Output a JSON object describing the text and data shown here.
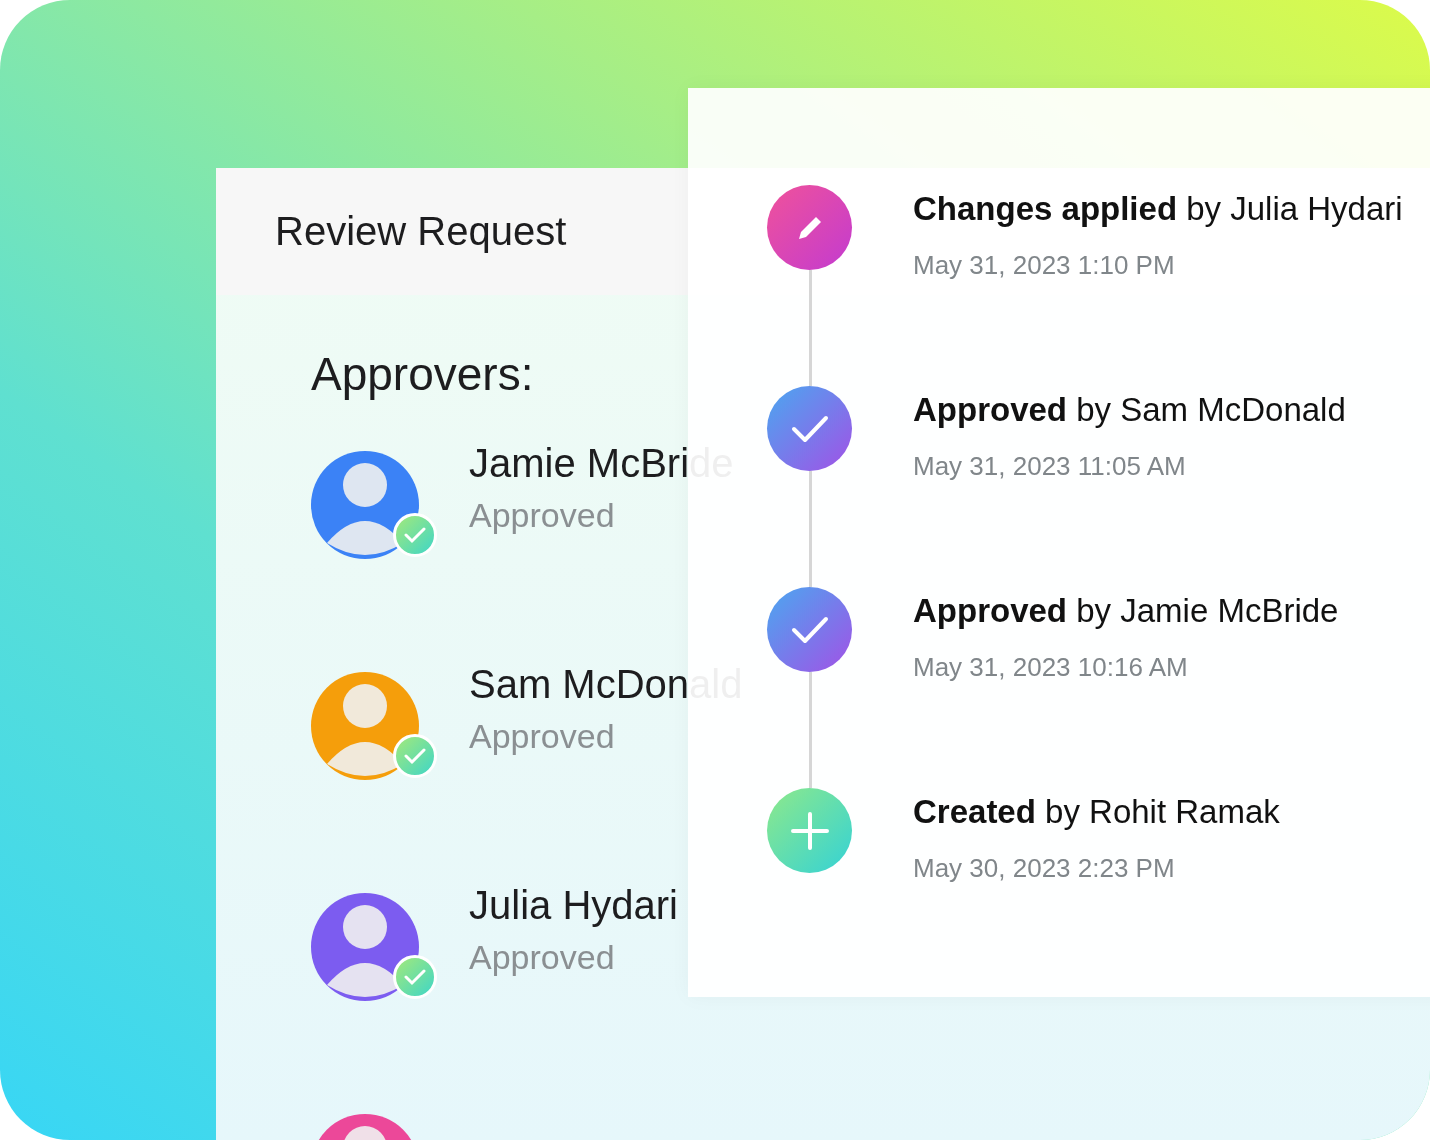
{
  "review_panel": {
    "title": "Review Request",
    "section_label": "Approvers:",
    "approvers": [
      {
        "name": "Jamie McBride",
        "status": "Approved",
        "approved": true,
        "color": "#3b82f6"
      },
      {
        "name": "Sam McDonald",
        "status": "Approved",
        "approved": true,
        "color": "#f59e0b"
      },
      {
        "name": "Julia Hydari",
        "status": "Approved",
        "approved": true,
        "color": "#7c5cf0"
      },
      {
        "color": "#ec4899"
      }
    ]
  },
  "activity": [
    {
      "kind": "edit",
      "title": "**Changes applied** by Julia Hydari",
      "time": "May 31, 2023 1:10 PM"
    },
    {
      "kind": "approve",
      "title": "**Approved** by Sam McDonald",
      "time": "May 31, 2023 11:05 AM"
    },
    {
      "kind": "approve",
      "title": "**Approved** by Jamie McBride",
      "time": "May 31, 2023 10:16 AM"
    },
    {
      "kind": "create",
      "title": "**Created** by Rohit Ramak",
      "time": "May 30, 2023 2:23 PM"
    }
  ]
}
